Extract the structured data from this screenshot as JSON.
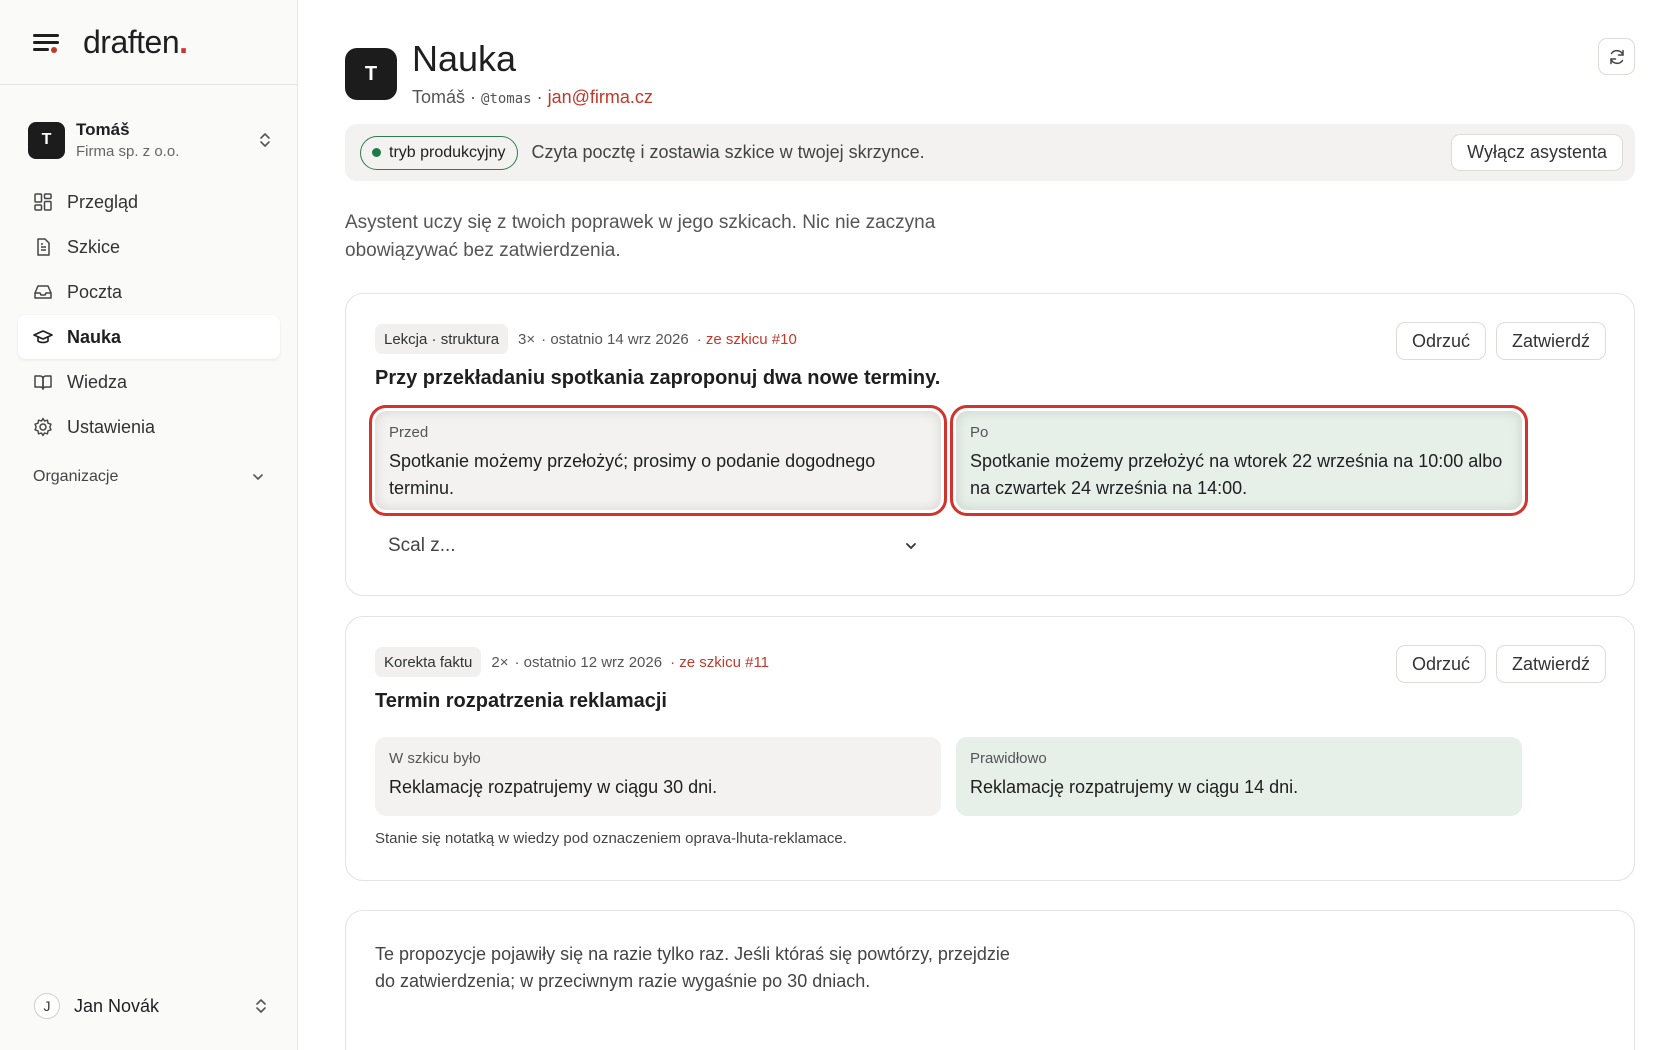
{
  "brand": {
    "name": "draften",
    "accent": "."
  },
  "account": {
    "initial": "T",
    "name": "Tomáš",
    "org": "Firma sp. z o.o."
  },
  "nav": {
    "items": [
      {
        "label": "Przegląd",
        "icon": "grid-icon"
      },
      {
        "label": "Szkice",
        "icon": "document-icon"
      },
      {
        "label": "Poczta",
        "icon": "inbox-icon"
      },
      {
        "label": "Nauka",
        "icon": "graduation-cap-icon",
        "active": true
      },
      {
        "label": "Wiedza",
        "icon": "book-icon"
      },
      {
        "label": "Ustawienia",
        "icon": "gear-icon"
      }
    ],
    "section": "Organizacje"
  },
  "user": {
    "initial": "J",
    "name": "Jan Novák"
  },
  "header": {
    "initial": "T",
    "title": "Nauka",
    "name": "Tomáš",
    "sep1": " · ",
    "handle": "@tomas",
    "sep2": " · ",
    "email": "jan@firma.cz"
  },
  "mode": {
    "pill": "tryb produkcyjny",
    "text": "Czyta pocztę i zostawia szkice w twojej skrzynce.",
    "button": "Wyłącz asystenta"
  },
  "intro": "Asystent uczy się z twoich poprawek w jego szkicach. Nic nie zaczyna obowiązywać bez zatwierdzenia.",
  "lessons": [
    {
      "tag": "Lekcja · struktura",
      "count": "3×",
      "date": "· ostatnio 14 wrz 2026",
      "source": "· ze szkicu #10",
      "reject": "Odrzuć",
      "approve": "Zatwierdź",
      "title": "Przy przekładaniu spotkania zaproponuj dwa nowe terminy.",
      "before_label": "Przed",
      "before_text": "Spotkanie możemy przełożyć; prosimy o podanie dogodnego terminu.",
      "after_label": "Po",
      "after_text": "Spotkanie możemy przełożyć na wtorek 22 września na 10:00 albo na czwartek 24 września na 14:00.",
      "merge_placeholder": "Scal z..."
    },
    {
      "tag": "Korekta faktu",
      "count": "2×",
      "date": "· ostatnio 12 wrz 2026",
      "source": "· ze szkicu #11",
      "reject": "Odrzuć",
      "approve": "Zatwierdź",
      "title": "Termin rozpatrzenia reklamacji",
      "before_label": "W szkicu było",
      "before_text": "Reklamację rozpatrujemy w ciągu 30 dni.",
      "after_label": "Prawidłowo",
      "after_text": "Reklamację rozpatrujemy w ciągu 14 dni.",
      "note": "Stanie się notatką w wiedzy pod oznaczeniem oprava-lhuta-reklamace."
    }
  ],
  "pending": {
    "text": "Te propozycje pojawiły się na razie tylko raz. Jeśli któraś się powtórzy, przejdzie do zatwierdzenia; w przeciwnym razie wygaśnie po 30 dniach."
  },
  "colors": {
    "accent": "#d0342c",
    "success": "#1e7b47",
    "after_bg": "#e6efe8"
  }
}
